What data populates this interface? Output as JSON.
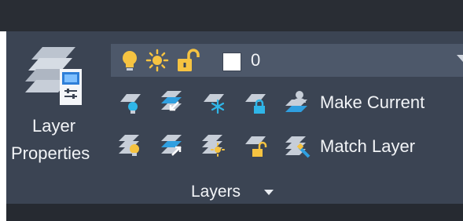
{
  "ribbon": {
    "layer_properties": {
      "line1": "Layer",
      "line2": "Properties",
      "icon": "layer-properties-icon"
    },
    "current_layer": {
      "value": "0",
      "icons": [
        "lightbulb-on-icon",
        "sun-icon",
        "lock-open-icon"
      ],
      "color_swatch": "#ffffff"
    },
    "tools_row1": [
      "layer-isolate-icon",
      "layer-previous-icon",
      "layer-freeze-icon",
      "layer-lock-icon"
    ],
    "tools_row2": [
      "layer-unisolate-icon",
      "layer-walk-icon",
      "layer-thaw-icon",
      "layer-unlock-icon"
    ],
    "make_current": {
      "label": "Make Current",
      "icon": "make-current-icon"
    },
    "match_layer": {
      "label": "Match Layer",
      "icon": "match-layer-icon"
    },
    "panel_title": "Layers"
  },
  "colors": {
    "panel_bg": "#3b4453",
    "dropdown_bg": "#4d586a",
    "topbar": "#292d34",
    "text": "#f2f4f7",
    "bulb_yellow": "#f6c341"
  }
}
